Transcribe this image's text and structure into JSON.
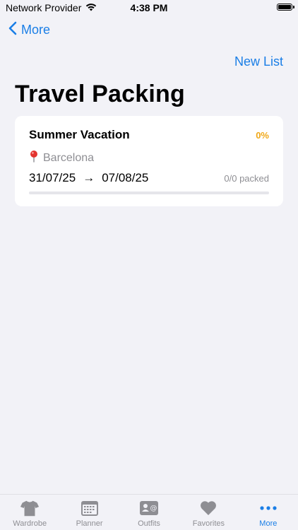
{
  "status_bar": {
    "carrier": "Network Provider",
    "time": "4:38 PM"
  },
  "nav": {
    "back_label": "More",
    "action_label": "New List"
  },
  "page": {
    "title": "Travel Packing"
  },
  "lists": [
    {
      "name": "Summer Vacation",
      "percent_label": "0%",
      "progress": 0,
      "location": "Barcelona",
      "start_date": "31/07/25",
      "arrow": "→",
      "end_date": "07/08/25",
      "packed_label": "0/0 packed"
    }
  ],
  "tab_bar": {
    "items": [
      {
        "label": "Wardrobe",
        "icon": "tshirt-icon",
        "active": false
      },
      {
        "label": "Planner",
        "icon": "calendar-icon",
        "active": false
      },
      {
        "label": "Outfits",
        "icon": "contact-card-icon",
        "active": false
      },
      {
        "label": "Favorites",
        "icon": "heart-icon",
        "active": false
      },
      {
        "label": "More",
        "icon": "ellipsis-icon",
        "active": true
      }
    ]
  },
  "colors": {
    "accent": "#1a7ee6",
    "progress": "#f0a818",
    "secondary_text": "#8e8e93",
    "background": "#f2f2f7"
  }
}
